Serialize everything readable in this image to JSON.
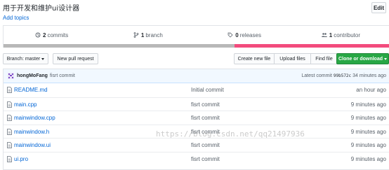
{
  "repo": {
    "description": "用于开发和维护ui设计器",
    "add_topics": "Add topics",
    "edit_label": "Edit"
  },
  "summary": {
    "commits_count": "2",
    "commits_label": "commits",
    "branches_count": "1",
    "branches_label": "branch",
    "releases_count": "0",
    "releases_label": "releases",
    "contributors_count": "1",
    "contributors_label": "contributor",
    "language_colors": [
      "#b8b8b8",
      "#f34b7d"
    ]
  },
  "toolbar": {
    "branch_label": "Branch: master",
    "pull_request_label": "New pull request",
    "create_file_label": "Create new file",
    "upload_files_label": "Upload files",
    "find_file_label": "Find file",
    "clone_label": "Clone or download",
    "clone_color": "#28a745"
  },
  "commit": {
    "author": "hongMoFang",
    "message": "fisrt commit",
    "latest_prefix": "Latest commit",
    "sha": "99b572c",
    "age": "34 minutes ago"
  },
  "files": [
    {
      "name": "README.md",
      "message": "Initial commit",
      "age": "an hour ago"
    },
    {
      "name": "main.cpp",
      "message": "fisrt commit",
      "age": "9 minutes ago"
    },
    {
      "name": "mainwindow.cpp",
      "message": "fisrt commit",
      "age": "9 minutes ago"
    },
    {
      "name": "mainwindow.h",
      "message": "fisrt commit",
      "age": "9 minutes ago"
    },
    {
      "name": "mainwindow.ui",
      "message": "fisrt commit",
      "age": "9 minutes ago"
    },
    {
      "name": "ui.pro",
      "message": "fisrt commit",
      "age": "9 minutes ago"
    }
  ],
  "watermark": "https://blog.csdn.net/qq21497936"
}
